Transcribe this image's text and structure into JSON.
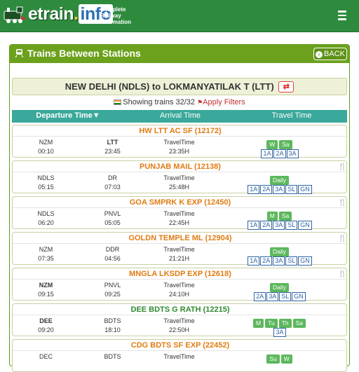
{
  "header": {
    "logo_text": "etrain",
    "logo_dot": ".",
    "logo_info": "info",
    "tagline": "Complete Railway Information",
    "menu_icon": "hamburger-icon"
  },
  "panel": {
    "title": "Trains Between Stations",
    "back_label": "BACK"
  },
  "route": {
    "text": "NEW DELHI (NDLS) to LOKMANYATILAK T (LTT)"
  },
  "showing": {
    "text": "Showing trains 32/32",
    "filter_label": "Apply Filters"
  },
  "columns": {
    "departure": "Departure Time",
    "arrival": "Arrival Time",
    "travel": "Travel Time"
  },
  "colors": {
    "topbar": "#2e8b3e",
    "panel": "#6ba11c",
    "column_header": "#3aa89a",
    "train_orange": "#e07b12",
    "train_green": "#2f8a2f",
    "day_badge": "#5cb85c",
    "class_badge": "#2f63a3"
  },
  "trains": [
    {
      "name": "HW LTT AC SF (12172)",
      "color": "#e07b12",
      "food": false,
      "from": "NZM",
      "to": "LTT",
      "travel_label": "TravelTime",
      "dep": "00:10",
      "arr": "23:45",
      "dur": "23:35H",
      "days": [
        "W",
        "Sa"
      ],
      "classes": [
        "1A",
        "2A",
        "3A"
      ],
      "bold_to": true
    },
    {
      "name": "PUNJAB MAIL (12138)",
      "color": "#e07b12",
      "food": true,
      "from": "NDLS",
      "to": "DR",
      "travel_label": "TravelTime",
      "dep": "05:15",
      "arr": "07:03",
      "dur": "25:48H",
      "days": [
        "Daily"
      ],
      "classes": [
        "1A",
        "2A",
        "3A",
        "SL",
        "GN"
      ]
    },
    {
      "name": "GOA SMPRK K EXP (12450)",
      "color": "#e07b12",
      "food": true,
      "from": "NDLS",
      "to": "PNVL",
      "travel_label": "TravelTime",
      "dep": "06:20",
      "arr": "05:05",
      "dur": "22:45H",
      "days": [
        "M",
        "Sa"
      ],
      "classes": [
        "1A",
        "2A",
        "3A",
        "SL",
        "GN"
      ]
    },
    {
      "name": "GOLDN TEMPLE ML (12904)",
      "color": "#e07b12",
      "food": true,
      "from": "NZM",
      "to": "DDR",
      "travel_label": "TravelTime",
      "dep": "07:35",
      "arr": "04:56",
      "dur": "21:21H",
      "days": [
        "Daily"
      ],
      "classes": [
        "1A",
        "2A",
        "3A",
        "SL",
        "GN"
      ]
    },
    {
      "name": "MNGLA LKSDP EXP (12618)",
      "color": "#e07b12",
      "food": true,
      "from": "NZM",
      "to": "PNVL",
      "travel_label": "TravelTime",
      "dep": "09:15",
      "arr": "09:25",
      "dur": "24:10H",
      "days": [
        "Daily"
      ],
      "classes": [
        "2A",
        "3A",
        "SL",
        "GN"
      ],
      "bold_from": true
    },
    {
      "name": "DEE BDTS G RATH (12215)",
      "color": "#2f8a2f",
      "food": false,
      "from": "DEE",
      "to": "BDTS",
      "travel_label": "TravelTime",
      "dep": "09:20",
      "arr": "18:10",
      "dur": "22:50H",
      "days": [
        "M",
        "Tu",
        "Th",
        "Sa"
      ],
      "classes": [
        "3A"
      ],
      "bold_from": true
    },
    {
      "name": "CDG BDTS SF EXP (22452)",
      "color": "#e07b12",
      "food": false,
      "from": "DEC",
      "to": "BDTS",
      "travel_label": "TravelTime",
      "dep": "",
      "arr": "",
      "dur": "",
      "days": [
        "Su",
        "W"
      ],
      "classes": []
    }
  ]
}
